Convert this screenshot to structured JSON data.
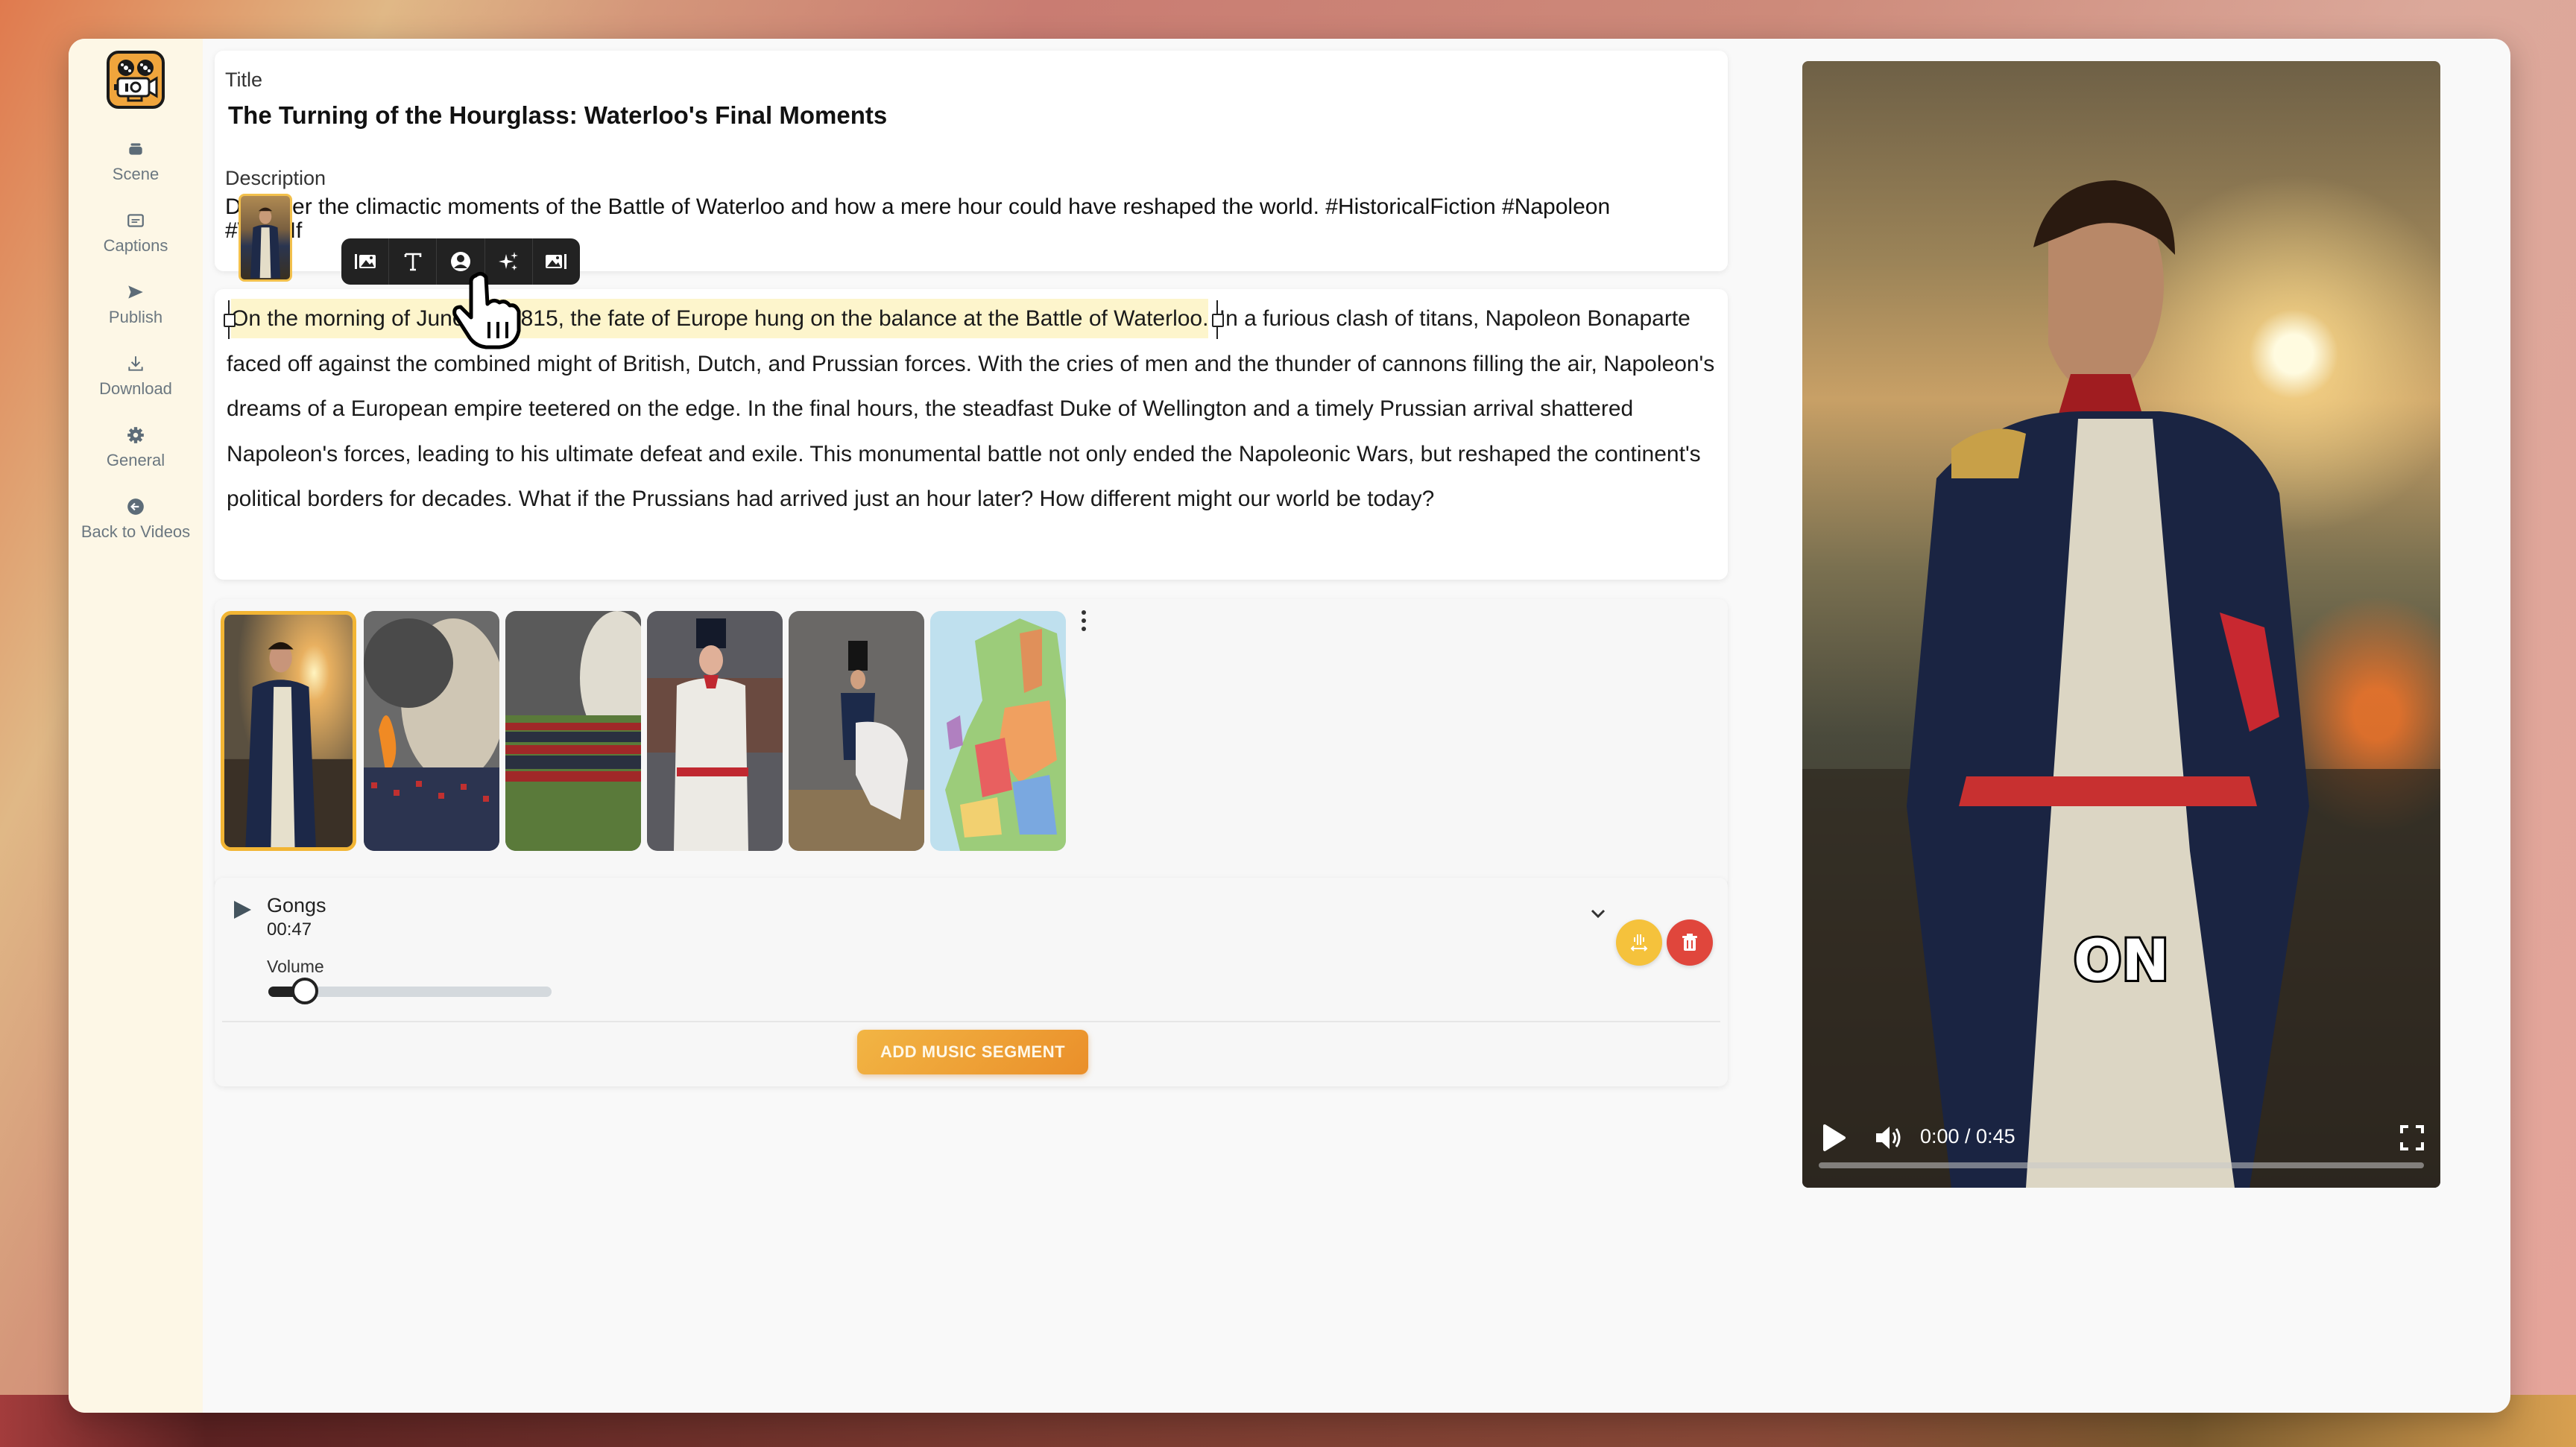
{
  "sidebar": {
    "logo": "movie-camera-logo",
    "items": [
      {
        "label": "Scene",
        "icon": "layers-icon"
      },
      {
        "label": "Captions",
        "icon": "captions-icon"
      },
      {
        "label": "Publish",
        "icon": "send-icon"
      },
      {
        "label": "Download",
        "icon": "download-icon"
      },
      {
        "label": "General",
        "icon": "gear-icon"
      },
      {
        "label": "Back to Videos",
        "icon": "back-arrow-icon"
      }
    ]
  },
  "meta": {
    "title_label": "Title",
    "title_value": "The Turning of the Hourglass: Waterloo's Final Moments",
    "description_label": "Description",
    "description_value": "Discover the climactic moments of the Battle of Waterloo and how a mere hour could have reshaped the world. #HistoricalFiction #Napoleon #WhatIf"
  },
  "toolbar": {
    "buttons": [
      {
        "name": "image-left",
        "icon": "image-left-icon"
      },
      {
        "name": "text",
        "icon": "text-icon"
      },
      {
        "name": "avatar",
        "icon": "person-icon"
      },
      {
        "name": "ai-generate",
        "icon": "sparkle-icon"
      },
      {
        "name": "image-right",
        "icon": "image-right-icon"
      }
    ]
  },
  "script": {
    "highlighted_segment": "On the morning of June 18, 1815, the fate of Europe hung on the balance at the Battle of Waterloo.",
    "rest": "In a furious clash of titans, Napoleon Bonaparte faced off against the combined might of British, Dutch, and Prussian forces. With the cries of men and the thunder of cannons filling the air, Napoleon's dreams of a European empire teetered on the edge. In the final hours, the steadfast Duke of Wellington and a timely Prussian arrival shattered Napoleon's forces, leading to his ultimate defeat and exile. This monumental battle not only ended the Napoleonic Wars, but reshaped the continent's political borders for decades. What if the Prussians had arrived just an hour later? How different might our world be today?"
  },
  "gallery": {
    "selected_index": 0,
    "scenes": [
      {
        "alt": "Napoleon portrait at sunset"
      },
      {
        "alt": "Battle smoke and fire"
      },
      {
        "alt": "Army lines with cannon smoke"
      },
      {
        "alt": "Officer in white uniform"
      },
      {
        "alt": "Napoleon on white horse"
      },
      {
        "alt": "Map of Europe"
      }
    ]
  },
  "music": {
    "track_name": "Gongs",
    "duration": "00:47",
    "volume_label": "Volume",
    "volume": 0.13,
    "add_button": "ADD MUSIC SEGMENT"
  },
  "video": {
    "caption_word": "ON",
    "time": "0:00 / 0:45",
    "progress": 0
  },
  "colors": {
    "accent": "#f2b534",
    "danger": "#e0463c",
    "highlight": "#fdf5cc",
    "sidebar_bg": "#fdf7e6"
  }
}
